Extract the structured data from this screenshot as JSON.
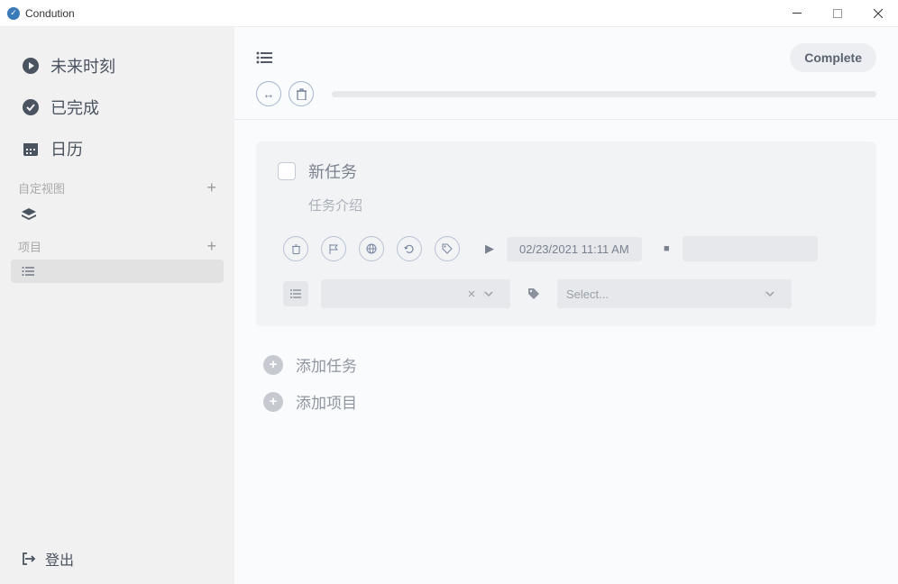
{
  "app_title": "Condution",
  "sidebar": {
    "nav": [
      {
        "label": "未来时刻",
        "icon": "play"
      },
      {
        "label": "已完成",
        "icon": "check"
      },
      {
        "label": "日历",
        "icon": "calendar"
      }
    ],
    "custom_view_label": "自定视图",
    "projects_label": "项目",
    "logout_label": "登出"
  },
  "main": {
    "complete_label": "Complete",
    "task": {
      "title": "新任务",
      "description": "任务介绍",
      "date": "02/23/2021 11:11 AM",
      "select_placeholder": "Select..."
    },
    "add_task_label": "添加任务",
    "add_project_label": "添加项目"
  }
}
